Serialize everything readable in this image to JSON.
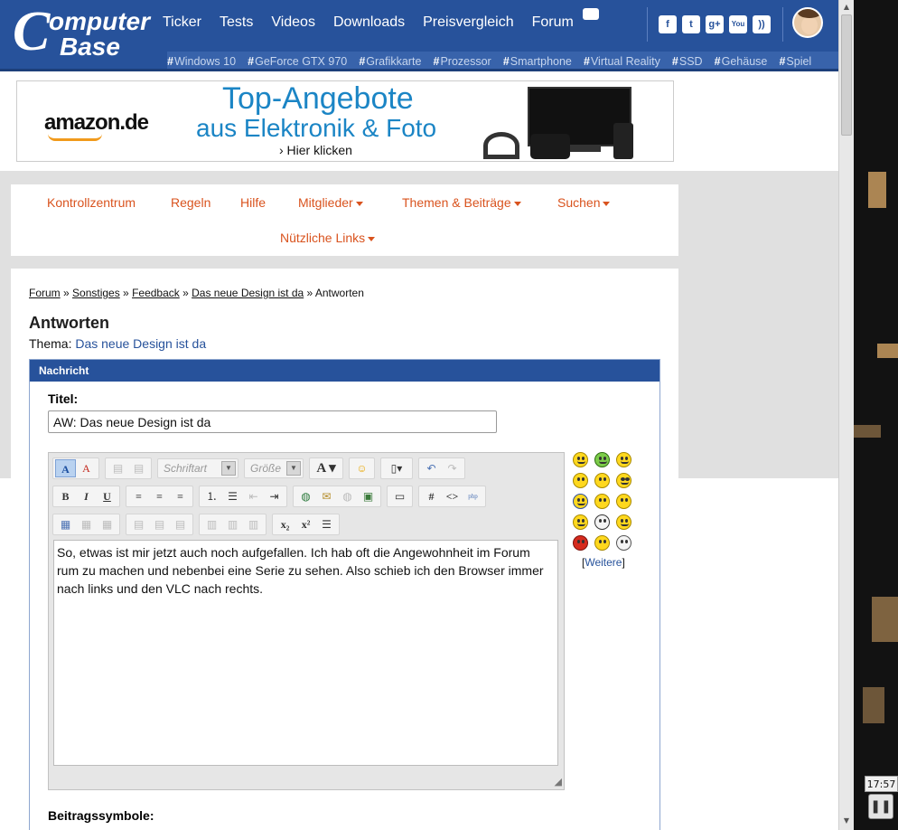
{
  "header": {
    "logo_top": "omputer",
    "logo_bottom": "ase",
    "nav": [
      "Ticker",
      "Tests",
      "Videos",
      "Downloads",
      "Preisvergleich",
      "Forum"
    ],
    "tags": [
      "Windows 10",
      "GeForce GTX 970",
      "Grafikkarte",
      "Prozessor",
      "Smartphone",
      "Virtual Reality",
      "SSD",
      "Gehäuse",
      "Spiel"
    ],
    "social": [
      {
        "icon": "facebook-icon",
        "glyph": "f"
      },
      {
        "icon": "twitter-icon",
        "glyph": "t"
      },
      {
        "icon": "googleplus-icon",
        "glyph": "g+"
      },
      {
        "icon": "youtube-icon",
        "glyph": "You"
      },
      {
        "icon": "rss-icon",
        "glyph": "))"
      }
    ]
  },
  "ad": {
    "brand": "amazon.de",
    "headline1": "Top-Angebote",
    "headline2": "aus Elektronik & Foto",
    "cta": "› Hier klicken"
  },
  "forum_nav": {
    "items": [
      "Kontrollzentrum",
      "Regeln",
      "Hilfe",
      "Mitglieder",
      "Themen & Beiträge",
      "Suchen",
      "Nützliche Links"
    ]
  },
  "breadcrumb": [
    "Forum",
    "Sonstiges",
    "Feedback",
    "Das neue Design ist da",
    "Antworten"
  ],
  "page": {
    "title": "Antworten",
    "theme_label": "Thema:",
    "theme_link": "Das neue Design ist da"
  },
  "panel": {
    "header": "Nachricht",
    "title_label": "Titel:",
    "title_value": "AW: Das neue Design ist da",
    "font_placeholder": "Schriftart",
    "size_placeholder": "Größe",
    "message": "So, etwas ist mir jetzt auch noch aufgefallen. Ich hab oft die Angewohnheit im Forum rum zu machen und nebenbei eine Serie zu sehen. Also schieb ich den Browser immer nach links und den VLC nach rechts.",
    "smilies_more": "Weitere",
    "symbols_label": "Beitragssymbole:"
  },
  "taskbar": {
    "clock": "17:57"
  }
}
